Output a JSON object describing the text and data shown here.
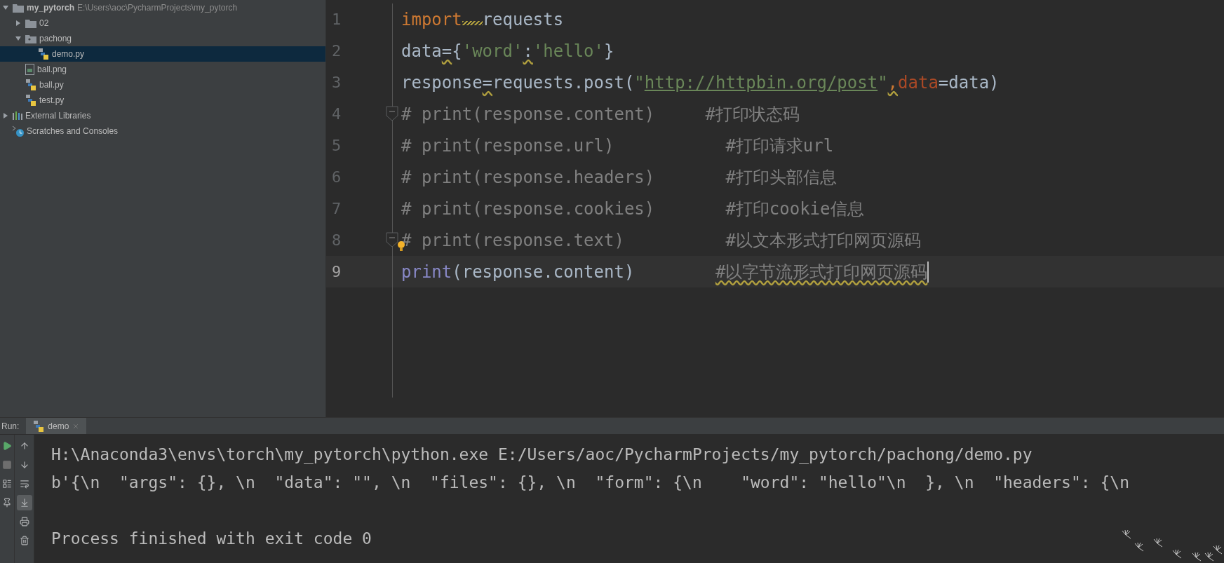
{
  "project_tree": {
    "items": [
      {
        "label": "my_pytorch",
        "path": "E:\\Users\\aoc\\PycharmProjects\\my_pytorch",
        "kind": "folder",
        "expanded": true,
        "selected": false,
        "children": [
          {
            "label": "02",
            "kind": "folder",
            "expanded": false,
            "selected": false
          },
          {
            "label": "pachong",
            "kind": "package",
            "expanded": true,
            "selected": false,
            "children": [
              {
                "label": "demo.py",
                "kind": "python",
                "selected": true
              }
            ]
          },
          {
            "label": "ball.png",
            "kind": "image",
            "selected": false
          },
          {
            "label": "ball.py",
            "kind": "python",
            "selected": false
          },
          {
            "label": "test.py",
            "kind": "python",
            "selected": false
          }
        ]
      },
      {
        "label": "External Libraries",
        "kind": "libraries",
        "expanded": false,
        "selected": false
      },
      {
        "label": "Scratches and Consoles",
        "kind": "scratches",
        "selected": false
      }
    ]
  },
  "editor": {
    "lines": [
      {
        "number": "1",
        "current": false,
        "fold": false,
        "bulb": false,
        "tokens": [
          {
            "kind": "keyword",
            "text": "import",
            "squiggle": false,
            "gap_warning": true
          },
          {
            "kind": "plain",
            "text": "requests",
            "squiggle": false
          }
        ]
      },
      {
        "number": "2",
        "current": false,
        "fold": false,
        "bulb": false,
        "tokens": [
          {
            "kind": "plain",
            "text": "data",
            "squiggle": false
          },
          {
            "kind": "plain",
            "text": "=",
            "squiggle": true
          },
          {
            "kind": "plain",
            "text": "{",
            "squiggle": false
          },
          {
            "kind": "string",
            "text": "'word'",
            "squiggle": false
          },
          {
            "kind": "plain",
            "text": ":",
            "squiggle": true
          },
          {
            "kind": "string",
            "text": "'hello'",
            "squiggle": false
          },
          {
            "kind": "plain",
            "text": "}",
            "squiggle": false
          }
        ]
      },
      {
        "number": "3",
        "current": false,
        "fold": false,
        "bulb": false,
        "tokens": [
          {
            "kind": "plain",
            "text": "response",
            "squiggle": false
          },
          {
            "kind": "plain",
            "text": "=",
            "squiggle": true
          },
          {
            "kind": "plain",
            "text": "requests.post(",
            "squiggle": false
          },
          {
            "kind": "string",
            "text": "\"",
            "squiggle": false
          },
          {
            "kind": "url",
            "text": "http://httpbin.org/post",
            "squiggle": false
          },
          {
            "kind": "string",
            "text": "\"",
            "squiggle": false
          },
          {
            "kind": "keyword",
            "text": ",",
            "squiggle": true
          },
          {
            "kind": "param",
            "text": "data",
            "squiggle": false
          },
          {
            "kind": "plain",
            "text": "=data)",
            "squiggle": false
          }
        ]
      },
      {
        "number": "4",
        "current": false,
        "fold": true,
        "bulb": false,
        "tokens": [
          {
            "kind": "comment",
            "text": "# print(response.content)     #打印状态码",
            "squiggle": false
          }
        ]
      },
      {
        "number": "5",
        "current": false,
        "fold": false,
        "bulb": false,
        "tokens": [
          {
            "kind": "comment",
            "text": "# print(response.url)           #打印请求url",
            "squiggle": false
          }
        ]
      },
      {
        "number": "6",
        "current": false,
        "fold": false,
        "bulb": false,
        "tokens": [
          {
            "kind": "comment",
            "text": "# print(response.headers)       #打印头部信息",
            "squiggle": false
          }
        ]
      },
      {
        "number": "7",
        "current": false,
        "fold": false,
        "bulb": false,
        "tokens": [
          {
            "kind": "comment",
            "text": "# print(response.cookies)       #打印cookie信息",
            "squiggle": false
          }
        ]
      },
      {
        "number": "8",
        "current": false,
        "fold": true,
        "bulb": true,
        "tokens": [
          {
            "kind": "comment",
            "text": "# print(response.text)          #以文本形式打印网页源码",
            "squiggle": false
          }
        ]
      },
      {
        "number": "9",
        "current": true,
        "fold": false,
        "bulb": false,
        "tokens": [
          {
            "kind": "builtin",
            "text": "print",
            "squiggle": false
          },
          {
            "kind": "plain",
            "text": "(response.content)        ",
            "squiggle": false
          },
          {
            "kind": "comment",
            "text": "#以字节流形式打印网页源码",
            "squiggle": true
          }
        ]
      }
    ]
  },
  "run_panel": {
    "label": "Run:",
    "tabs": [
      {
        "label": "demo",
        "selected": true
      }
    ],
    "toolbar_left": [
      {
        "kind": "run",
        "active": false
      },
      {
        "kind": "stop",
        "active": false
      },
      {
        "kind": "layout",
        "active": false
      },
      {
        "kind": "pin",
        "active": false
      }
    ],
    "toolbar_right": [
      {
        "kind": "up",
        "active": false
      },
      {
        "kind": "down",
        "active": false
      },
      {
        "kind": "wrap",
        "active": false
      },
      {
        "kind": "scroll-end",
        "active": true
      },
      {
        "kind": "print",
        "active": false
      },
      {
        "kind": "trash",
        "active": false
      }
    ],
    "console": [
      {
        "kind": "command",
        "text": "H:\\Anaconda3\\envs\\torch\\my_pytorch\\python.exe E:/Users/aoc/PycharmProjects/my_pytorch/pachong/demo.py"
      },
      {
        "kind": "output",
        "text": "b'{\\n  \"args\": {}, \\n  \"data\": \"\", \\n  \"files\": {}, \\n  \"form\": {\\n    \"word\": \"hello\"\\n  }, \\n  \"headers\": {\\n"
      },
      {
        "kind": "status",
        "text": "Process finished with exit code 0"
      }
    ]
  }
}
